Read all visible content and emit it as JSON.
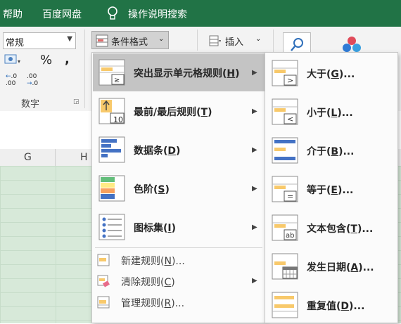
{
  "menubar": {
    "items": [
      "帮助",
      "百度网盘",
      "操作说明搜索"
    ]
  },
  "ribbon": {
    "number_format": "常规",
    "percent_symbol": "%",
    "comma_symbol": ",",
    "decimal_increase": ".00",
    "decimal_decrease": ".0",
    "number_group_label": "数字",
    "conditional_format_label": "条件格式",
    "insert_label": "插入"
  },
  "columns": [
    "G",
    "H"
  ],
  "main_menu": {
    "items": [
      {
        "label": "突出显示单元格规则(",
        "key": "H",
        "close": ")",
        "selected": true,
        "has_submenu": true
      },
      {
        "label": "最前/最后规则(",
        "key": "T",
        "close": ")",
        "has_submenu": true
      },
      {
        "label": "数据条(",
        "key": "D",
        "close": ")",
        "has_submenu": true
      },
      {
        "label": "色阶(",
        "key": "S",
        "close": ")",
        "has_submenu": true
      },
      {
        "label": "图标集(",
        "key": "I",
        "close": ")",
        "has_submenu": true
      }
    ],
    "small_items": [
      {
        "label": "新建规则(",
        "key": "N",
        "close": ")..."
      },
      {
        "label": "清除规则(",
        "key": "C",
        "close": ")",
        "has_submenu": true
      },
      {
        "label": "管理规则(",
        "key": "R",
        "close": ")..."
      }
    ],
    "top10_text": "10"
  },
  "sub_menu": {
    "items": [
      {
        "label": "大于(",
        "key": "G",
        "close": ")...",
        "icon_symbol": ">"
      },
      {
        "label": "小于(",
        "key": "L",
        "close": ")...",
        "icon_symbol": "<"
      },
      {
        "label": "介于(",
        "key": "B",
        "close": ")...",
        "icon_symbol": ""
      },
      {
        "label": "等于(",
        "key": "E",
        "close": ")...",
        "icon_symbol": "="
      },
      {
        "label": "文本包含(",
        "key": "T",
        "close": ")...",
        "icon_symbol": "ab"
      },
      {
        "label": "发生日期(",
        "key": "A",
        "close": ")...",
        "icon_symbol": ""
      },
      {
        "label": "重复值(",
        "key": "D",
        "close": ")...",
        "icon_symbol": ""
      }
    ]
  },
  "colors": {
    "title_bar": "#217346",
    "highlight_fill": "#f8c96b",
    "databar_blue": "#4472c4"
  }
}
